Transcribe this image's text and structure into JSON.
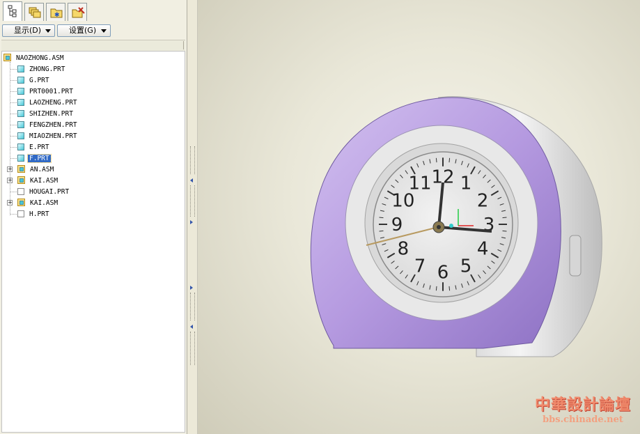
{
  "toolbar": {
    "tabs": [
      {
        "name": "model-tree-tab",
        "icon": "model-tree-icon",
        "active": true
      },
      {
        "name": "layers-tab",
        "icon": "layers-icon",
        "active": false
      },
      {
        "name": "folder-browser-tab",
        "icon": "folder-star-icon",
        "active": false
      },
      {
        "name": "favorites-tab",
        "icon": "folder-tools-icon",
        "active": false
      }
    ],
    "show_label": "显示(D)",
    "settings_label": "设置(G)"
  },
  "tree": {
    "root": {
      "label": "NAOZHONG.ASM",
      "type": "assembly"
    },
    "items": [
      {
        "label": "ZHONG.PRT",
        "type": "part",
        "expandable": false,
        "selected": false
      },
      {
        "label": "G.PRT",
        "type": "part",
        "expandable": false,
        "selected": false
      },
      {
        "label": "PRT0001.PRT",
        "type": "part",
        "expandable": false,
        "selected": false
      },
      {
        "label": "LAOZHENG.PRT",
        "type": "part",
        "expandable": false,
        "selected": false
      },
      {
        "label": "SHIZHEN.PRT",
        "type": "part",
        "expandable": false,
        "selected": false
      },
      {
        "label": "FENGZHEN.PRT",
        "type": "part",
        "expandable": false,
        "selected": false
      },
      {
        "label": "MIAOZHEN.PRT",
        "type": "part",
        "expandable": false,
        "selected": false
      },
      {
        "label": "E.PRT",
        "type": "part",
        "expandable": false,
        "selected": false
      },
      {
        "label": "F.PRT",
        "type": "part",
        "expandable": false,
        "selected": true
      },
      {
        "label": "AN.ASM",
        "type": "assembly",
        "expandable": true,
        "selected": false
      },
      {
        "label": "KAI.ASM",
        "type": "assembly",
        "expandable": true,
        "selected": false
      },
      {
        "label": "HOUGAI.PRT",
        "type": "blank-part",
        "expandable": false,
        "selected": false
      },
      {
        "label": "KAI.ASM",
        "type": "assembly",
        "expandable": true,
        "selected": false
      },
      {
        "label": "H.PRT",
        "type": "blank-part",
        "expandable": false,
        "selected": false
      }
    ]
  },
  "viewport": {
    "model": "alarm-clock-3d-model",
    "dial_numbers": [
      "12",
      "1",
      "2",
      "3",
      "4",
      "5",
      "6",
      "7",
      "8",
      "9",
      "10",
      "11"
    ],
    "colors": {
      "body": "#b59ae0",
      "body_dark": "#8e72c4",
      "back_shell": "#e6e6e6",
      "dial": "#ececec",
      "background": "#e9e7d8"
    }
  },
  "watermark": {
    "title": "中華設計論壇",
    "url": "bbs.chinade.net"
  }
}
